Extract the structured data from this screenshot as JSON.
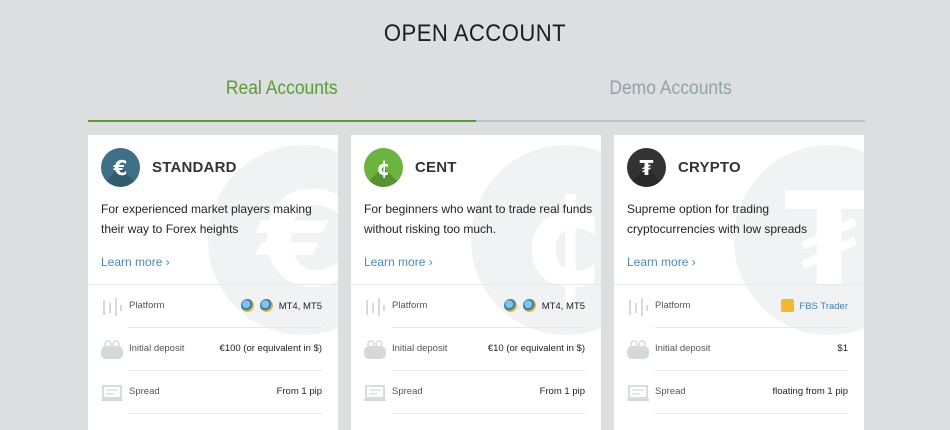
{
  "page": {
    "title": "OPEN ACCOUNT"
  },
  "tabs": [
    {
      "label": "Real Accounts",
      "active": true
    },
    {
      "label": "Demo Accounts",
      "active": false
    }
  ],
  "colors": {
    "active_tab": "#5a9a37",
    "inactive_tab": "#8fa3ad",
    "link": "#4a8ab0",
    "standard_icon": "#3e6f86",
    "cent_icon": "#6cb33f",
    "crypto_icon": "#333333"
  },
  "cards": [
    {
      "name": "STANDARD",
      "icon": "euro-icon",
      "glyph": "€",
      "description": "For experienced market players making their way to Forex heights",
      "learn_more": "Learn more ›",
      "rows": [
        {
          "label": "Platform",
          "icon": "platform-icon",
          "value": "MT4, MT5"
        },
        {
          "label": "Initial deposit",
          "icon": "wallet-icon",
          "value": "€100 (or equivalent in $)"
        },
        {
          "label": "Spread",
          "icon": "spread-icon",
          "value": "From 1 pip"
        }
      ]
    },
    {
      "name": "CENT",
      "icon": "cent-icon",
      "glyph": "¢",
      "description": "For beginners who want to trade real funds without risking too much.",
      "learn_more": "Learn more ›",
      "rows": [
        {
          "label": "Platform",
          "icon": "platform-icon",
          "value": "MT4, MT5"
        },
        {
          "label": "Initial deposit",
          "icon": "wallet-icon",
          "value": "€10 (or equivalent in $)"
        },
        {
          "label": "Spread",
          "icon": "spread-icon",
          "value": "From 1 pip"
        }
      ]
    },
    {
      "name": "CRYPTO",
      "icon": "tether-icon",
      "glyph": "₮",
      "description": "Supreme option for trading cryptocurrencies with low spreads",
      "learn_more": "Learn more ›",
      "rows": [
        {
          "label": "Platform",
          "icon": "platform-icon",
          "value": "FBS Trader"
        },
        {
          "label": "Initial deposit",
          "icon": "wallet-icon",
          "value": "$1"
        },
        {
          "label": "Spread",
          "icon": "spread-icon",
          "value": "floating from 1 pip"
        }
      ]
    }
  ]
}
